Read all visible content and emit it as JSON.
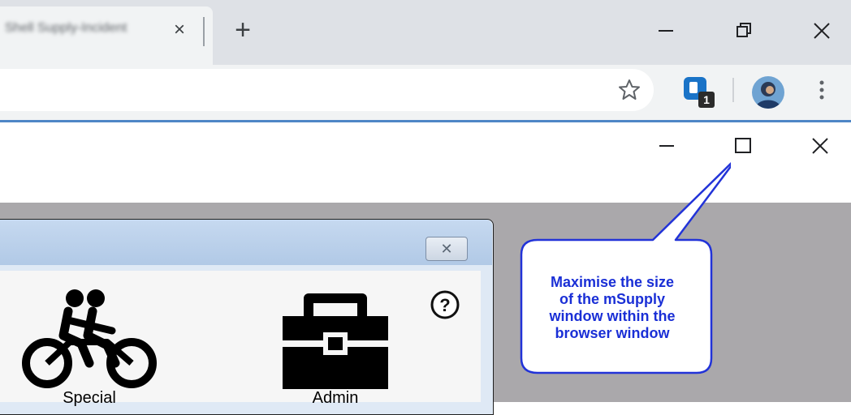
{
  "browser": {
    "tab": {
      "title": "Shell Supply-Incident",
      "close_glyph": "×"
    },
    "new_tab_glyph": "+",
    "extension_badge": "1"
  },
  "app": {
    "special_label": "Special",
    "admin_label": "Admin",
    "help_glyph": "?"
  },
  "callout": {
    "line1": "Maximise the size",
    "line2": "of the mSupply",
    "line3": "window within the",
    "line4": "browser window",
    "text_color": "#1a2fd6",
    "border_color": "#2233d8"
  },
  "colors": {
    "accent_line": "#4f86c6",
    "background_gray": "#aaa8ab"
  }
}
